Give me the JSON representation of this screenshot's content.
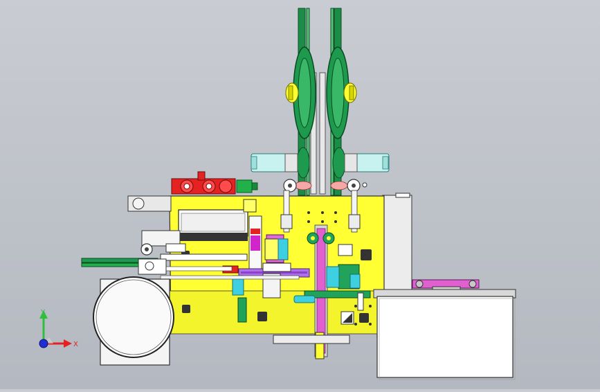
{
  "viewport": {
    "background": "#c4c7cd",
    "colors": {
      "frame": "#ffff33",
      "wheel": "#22a35a",
      "wheel_dark": "#0f6b34",
      "red_part": "#e52222",
      "purple_part": "#b070e8",
      "cyan_part": "#3ecfe0",
      "pink_part": "#e060d0",
      "grey_panel": "#d8d8d8"
    }
  },
  "triad": {
    "x_label": "X",
    "y_label": "Y",
    "x_color": "#e52020",
    "y_color": "#2fbf3f",
    "z_color": "#2030d0"
  }
}
